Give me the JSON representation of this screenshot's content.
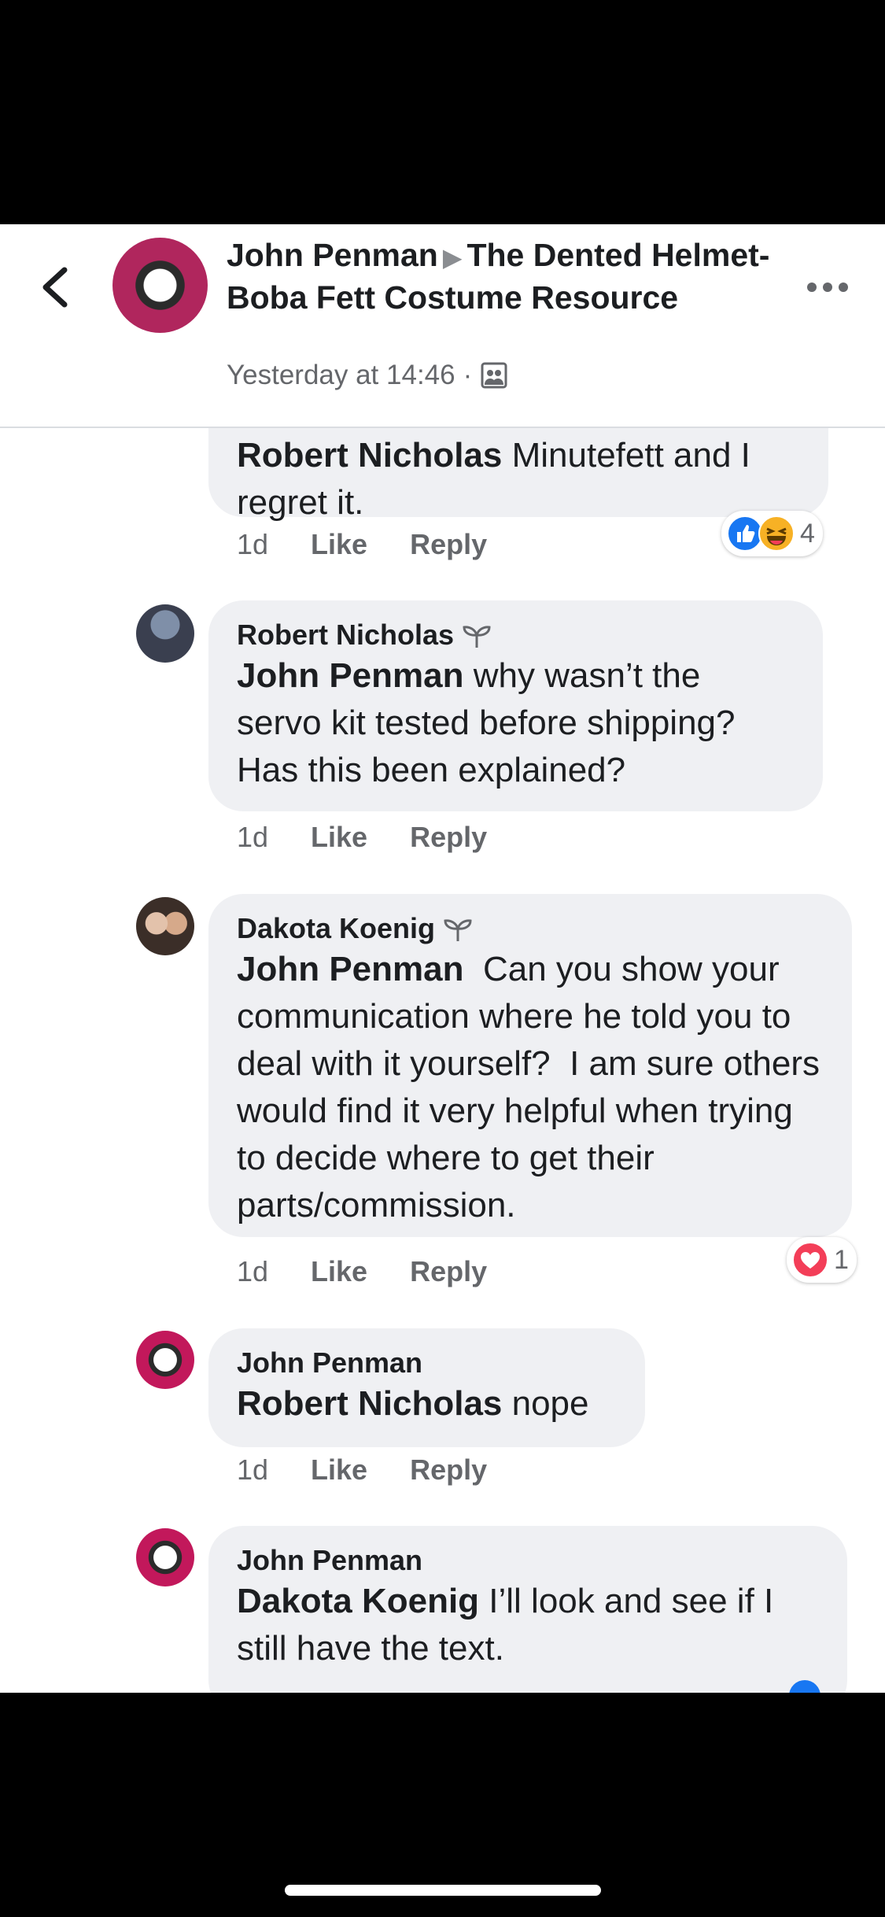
{
  "header": {
    "author": "John Penman",
    "group": "The Dented Helmet-Boba Fett Costume Resource",
    "timestamp": "Yesterday at 14:46",
    "separator": "·",
    "audience_icon": "group-icon",
    "back_icon": "chevron-left-icon",
    "more_icon": "more-dots-icon"
  },
  "comments": [
    {
      "author": "",
      "mention": "Robert Nicholas",
      "text": " Minutefett and I regret it.",
      "time": "1d",
      "like": "Like",
      "reply": "Reply",
      "reactions": {
        "icons": [
          "like",
          "haha"
        ],
        "count": "4"
      }
    },
    {
      "author": "Robert Nicholas",
      "mention": "John Penman",
      "text": " why wasn’t the servo kit tested before shipping? Has this been explained?",
      "time": "1d",
      "like": "Like",
      "reply": "Reply"
    },
    {
      "author": "Dakota Koenig",
      "mention": "John Penman",
      "text": "  Can you show your communication where he told you to deal with it yourself?  I am sure others would find it very helpful when trying to decide where to get their parts/commission.",
      "time": "1d",
      "like": "Like",
      "reply": "Reply",
      "reactions": {
        "icons": [
          "love"
        ],
        "count": "1"
      }
    },
    {
      "author": "John Penman",
      "mention": "Robert Nicholas",
      "text": " nope",
      "time": "1d",
      "like": "Like",
      "reply": "Reply"
    },
    {
      "author": "John Penman",
      "mention": "Dakota Koenig",
      "text": " I’ll look and see if I still have the text."
    }
  ],
  "colors": {
    "bubble": "#eff0f3",
    "like_blue": "#1877f2",
    "love_red": "#f33e58",
    "haha_yellow": "#f7b125"
  }
}
